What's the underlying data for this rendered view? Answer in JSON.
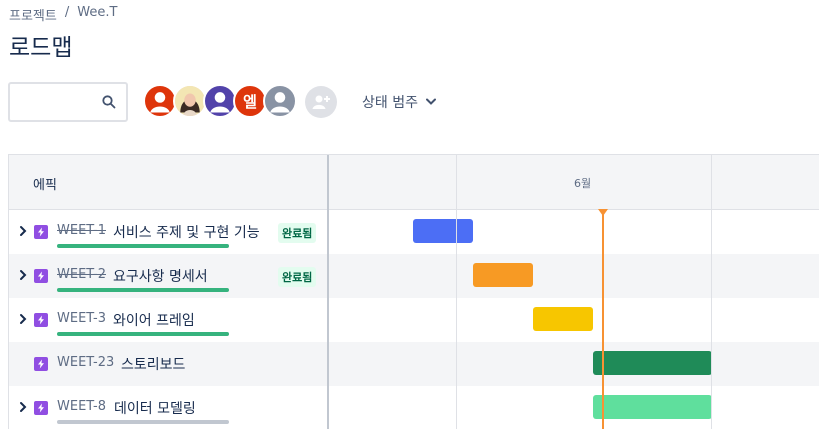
{
  "breadcrumb": {
    "project": "프로젝트",
    "separator": "/",
    "current": "Wee.T"
  },
  "page_title": "로드맵",
  "search": {
    "value": "",
    "placeholder": ""
  },
  "avatars": [
    {
      "kind": "person",
      "color": "#de350b"
    },
    {
      "kind": "photo",
      "color": "#f4d6c4"
    },
    {
      "kind": "person",
      "color": "#5243aa"
    },
    {
      "kind": "initial",
      "initial": "엘",
      "color": "#de350b"
    },
    {
      "kind": "person",
      "color": "#8993a4"
    }
  ],
  "add_user_icon": "add-user-icon",
  "status_filter": {
    "label": "상태 범주",
    "icon": "chevron-down-icon"
  },
  "table": {
    "epic_header": "에픽",
    "months": [
      {
        "label": ""
      },
      {
        "label": "6월"
      },
      {
        "label": ""
      }
    ],
    "done_badge": "완료됨",
    "rows": [
      {
        "key": "WEET-1",
        "title": "서비스 주제 및 구현 기능",
        "done": true,
        "expandable": true,
        "progress_color": "#36b37e",
        "bar_color": "#4c6ef5"
      },
      {
        "key": "WEET-2",
        "title": "요구사항 명세서",
        "done": true,
        "expandable": true,
        "progress_color": "#36b37e",
        "bar_color": "#f79a24"
      },
      {
        "key": "WEET-3",
        "title": "와이어 프레임",
        "done": false,
        "expandable": true,
        "progress_color": "#36b37e",
        "bar_color": "#f7c600"
      },
      {
        "key": "WEET-23",
        "title": "스토리보드",
        "done": false,
        "expandable": false,
        "progress_color": "",
        "bar_color": "#1f8b58"
      },
      {
        "key": "WEET-8",
        "title": "데이터 모델링",
        "done": false,
        "expandable": true,
        "progress_color": "#c1c7d0",
        "bar_color": "#5fdf9d"
      }
    ]
  },
  "colors": {
    "today_marker": "#f79233",
    "epic_icon": "#904ee2",
    "done_badge_text": "#006644",
    "done_badge_bg": "#e3fcef"
  }
}
